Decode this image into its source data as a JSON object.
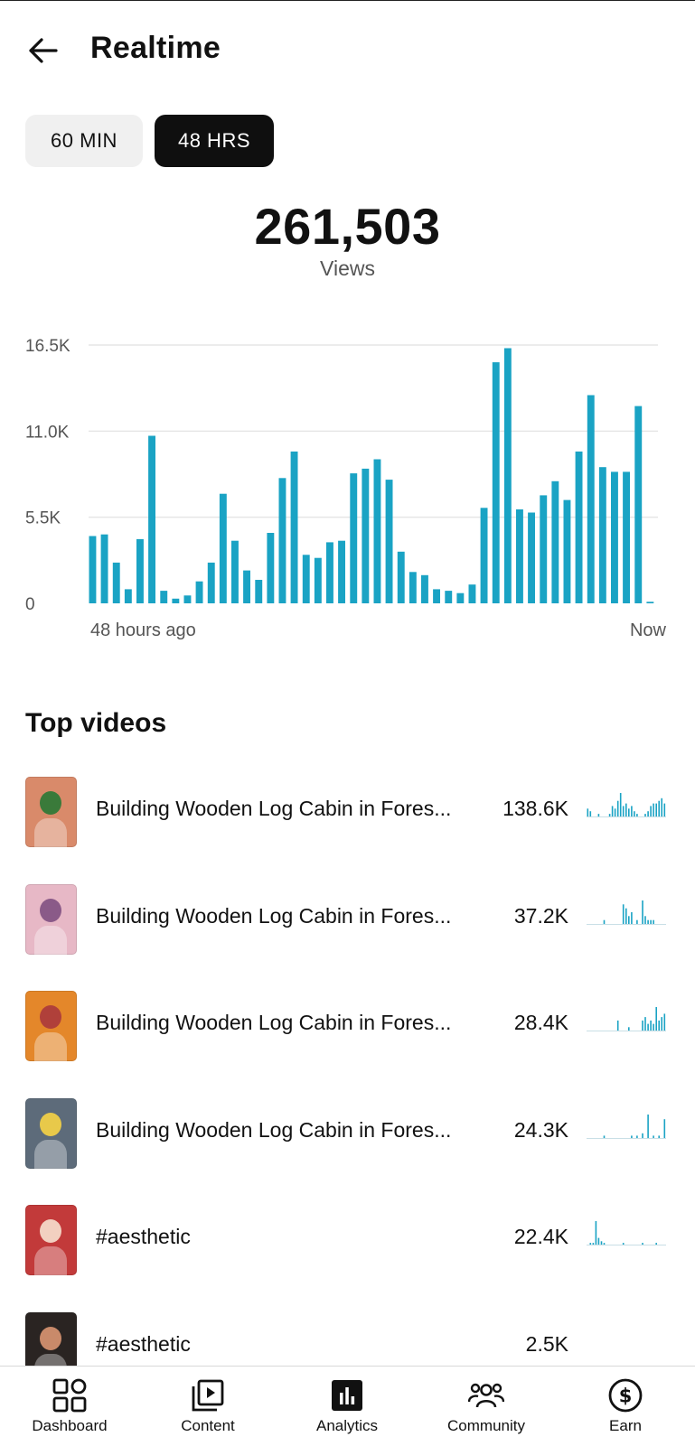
{
  "header": {
    "title": "Realtime",
    "back_icon": "arrow-left-icon"
  },
  "range_toggle": {
    "options": [
      "60 MIN",
      "48 HRS"
    ],
    "selected": "48 HRS"
  },
  "summary": {
    "total": "261,503",
    "label": "Views"
  },
  "chart_data": {
    "type": "bar",
    "y_tick_labels": [
      "16.5K",
      "11.0K",
      "5.5K",
      "0"
    ],
    "y_ticks": [
      16500,
      11000,
      5500,
      0
    ],
    "ylim": [
      0,
      16500
    ],
    "x_start_label": "48 hours ago",
    "x_end_label": "Now",
    "grid": true,
    "color": "#1aa3c4",
    "values": [
      4300,
      4400,
      2600,
      900,
      4100,
      10700,
      800,
      300,
      500,
      1400,
      2600,
      7000,
      4000,
      2100,
      1500,
      4500,
      8000,
      9700,
      3100,
      2900,
      3900,
      4000,
      8300,
      8600,
      9200,
      7900,
      3300,
      2000,
      1800,
      900,
      800,
      650,
      1200,
      6100,
      15400,
      16300,
      6000,
      5800,
      6900,
      7800,
      6600,
      9700,
      13300,
      8700,
      8400,
      8400,
      12600,
      100
    ]
  },
  "top_videos": {
    "title": "Top videos",
    "items": [
      {
        "title": "Building Wooden Log Cabin in Fores...",
        "views": "138.6K",
        "thumb_bg": "#d98a6a",
        "thumb_accent": "#3a7a3a",
        "spark": [
          3,
          2,
          0,
          0,
          1,
          0,
          0,
          0,
          1,
          4,
          3,
          6,
          9,
          4,
          5,
          3,
          4,
          2,
          1,
          0,
          0,
          1,
          2,
          4,
          5,
          5,
          6,
          7,
          5
        ]
      },
      {
        "title": "Building Wooden Log Cabin in Fores...",
        "views": "37.2K",
        "thumb_bg": "#e7b8c6",
        "thumb_accent": "#8a5a88",
        "spark": [
          0,
          0,
          0,
          0,
          0,
          0,
          1,
          0,
          0,
          0,
          0,
          0,
          0,
          5,
          4,
          2,
          3,
          0,
          1,
          0,
          6,
          2,
          1,
          1,
          1,
          0,
          0,
          0,
          0
        ]
      },
      {
        "title": "Building Wooden Log Cabin in Fores...",
        "views": "28.4K",
        "thumb_bg": "#e4872a",
        "thumb_accent": "#b0403a",
        "spark": [
          0,
          0,
          0,
          0,
          0,
          0,
          0,
          0,
          0,
          0,
          0,
          3,
          0,
          0,
          0,
          1,
          0,
          0,
          0,
          0,
          3,
          4,
          2,
          3,
          2,
          7,
          3,
          4,
          5
        ]
      },
      {
        "title": "Building Wooden Log Cabin in Fores...",
        "views": "24.3K",
        "thumb_bg": "#5d6b7a",
        "thumb_accent": "#e8c94a",
        "spark": [
          0,
          0,
          0,
          0,
          0,
          0,
          1,
          0,
          0,
          0,
          0,
          0,
          0,
          0,
          0,
          0,
          1,
          0,
          1,
          0,
          2,
          0,
          10,
          0,
          1,
          0,
          1,
          0,
          8
        ]
      },
      {
        "title": "#aesthetic",
        "views": "22.4K",
        "thumb_bg": "#c23a3a",
        "thumb_accent": "#f2d0c0",
        "spark": [
          0,
          1,
          1,
          14,
          4,
          2,
          1,
          0,
          0,
          0,
          0,
          0,
          0,
          1,
          0,
          0,
          0,
          0,
          0,
          0,
          1,
          0,
          0,
          0,
          0,
          1,
          0,
          0,
          0
        ]
      },
      {
        "title": "#aesthetic",
        "views": "2.5K",
        "thumb_bg": "#2a2422",
        "thumb_accent": "#c98a6a",
        "spark": []
      }
    ]
  },
  "nav": {
    "items": [
      {
        "label": "Dashboard",
        "icon": "dashboard-icon",
        "active": false
      },
      {
        "label": "Content",
        "icon": "content-icon",
        "active": false
      },
      {
        "label": "Analytics",
        "icon": "analytics-icon",
        "active": true
      },
      {
        "label": "Community",
        "icon": "community-icon",
        "active": false
      },
      {
        "label": "Earn",
        "icon": "earn-icon",
        "active": false
      }
    ]
  }
}
